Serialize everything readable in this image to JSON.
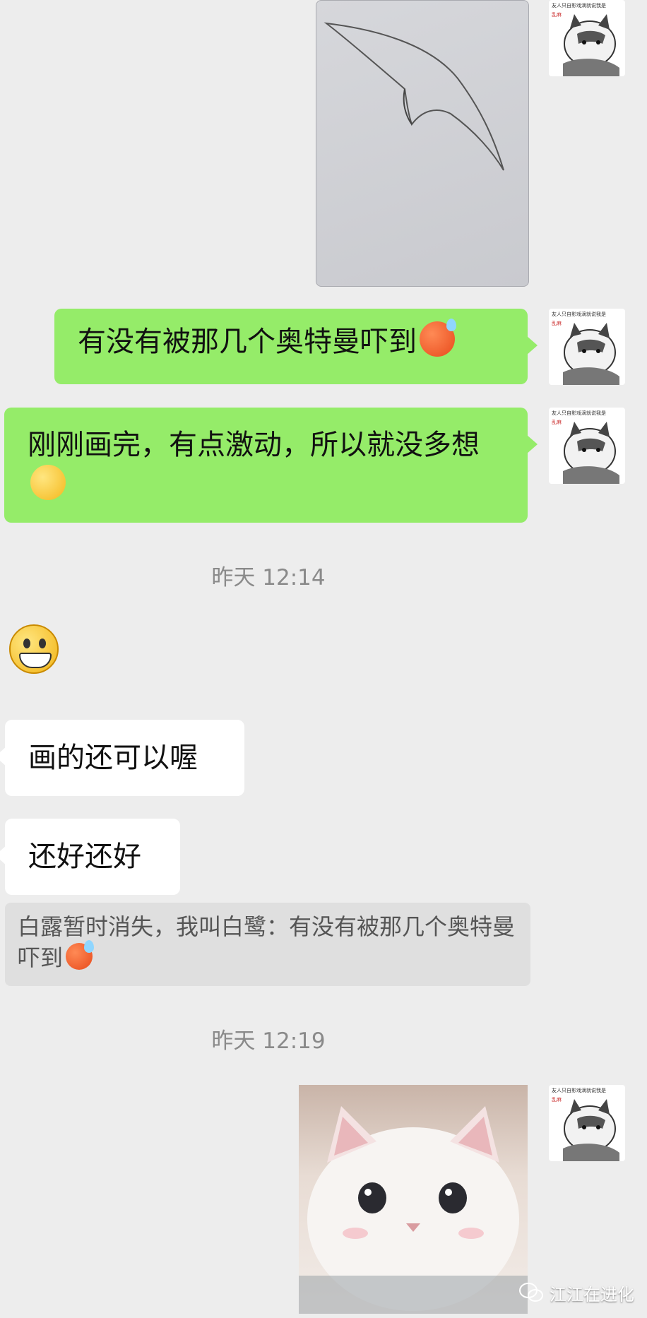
{
  "messages": {
    "msg1": "有没有被那几个奥特曼吓到",
    "msg2": "刚刚画完，有点激动，所以就没多想",
    "msg3": "画的还可以喔",
    "msg4": "还好还好"
  },
  "quote": {
    "text": "白露暂时消失，我叫白鹭：有没有被那几个奥特曼吓到"
  },
  "timestamps": {
    "t1": "昨天 12:14",
    "t2": "昨天 12:19"
  },
  "avatar": {
    "caption": "友人只自影戏滴就说我是",
    "tag": "乱麻"
  },
  "watermark": {
    "text": "江江在进化",
    "icon": "wechat-icon"
  },
  "colors": {
    "sent_bubble": "#95ec69",
    "received_bubble": "#ffffff",
    "background": "#ededed"
  }
}
